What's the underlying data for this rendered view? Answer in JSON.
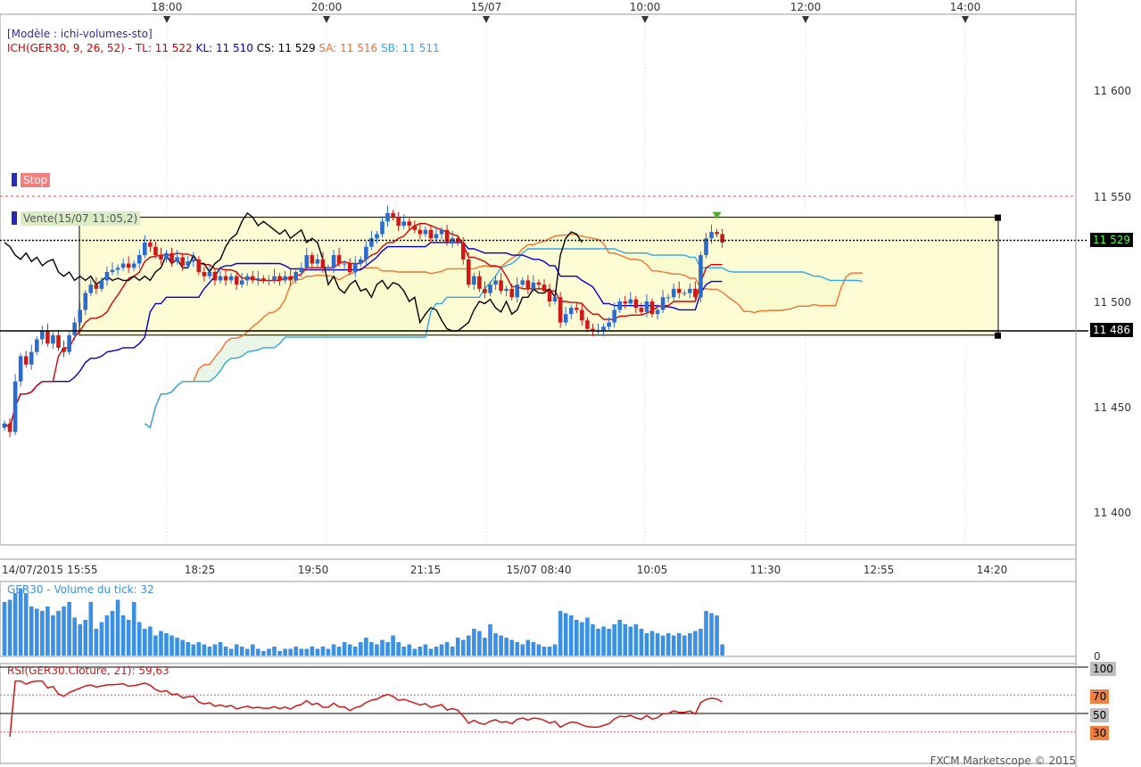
{
  "window": {
    "template_label": "[Modèle : ichi-volumes-sto]",
    "watermark": "FXCM Marketscope © 2015"
  },
  "legend": {
    "ich_label": "ICH(GER30, 9, 26, 52) -",
    "tl": "TL: 11 522",
    "kl": "KL: 11 510",
    "cs": "CS: 11 529",
    "sa": "SA: 11 516",
    "sb": "SB: 11 511"
  },
  "markers": {
    "stop": "Stop",
    "sell": "Vente(15/07 11:05,2)"
  },
  "price_labels": {
    "current": "11 529",
    "support": "11 486"
  },
  "volume_panel": {
    "label": "GER30 - Volume du tick: 32",
    "zero": "0"
  },
  "rsi_panel": {
    "label": "RSI(GER30.Cloture, 21): 59,63",
    "levels": [
      "100",
      "70",
      "50",
      "30"
    ]
  },
  "colors": {
    "tenkan": "#d40000",
    "kijun": "#0000c8",
    "chikou": "#000000",
    "senkou_a": "#f07030",
    "senkou_b": "#30a8e8",
    "bull_candle": "#2a6bd1",
    "bear_candle": "#d01818",
    "volume": "#3a8fe6",
    "rsi": "#d01818",
    "zone_fill": "#fdfbc6"
  },
  "chart_data": [
    {
      "type": "candlestick",
      "symbol": "GER30",
      "top_time_axis": [
        "18:00",
        "20:00",
        "15/07",
        "10:00",
        "12:00",
        "14:00"
      ],
      "bottom_time_axis": [
        "14/07/2015 15:55",
        "18:25",
        "19:50",
        "21:15",
        "15/07 08:40",
        "10:05",
        "11:30",
        "12:55",
        "14:20"
      ],
      "y_ticks": [
        "11 600",
        "11 550",
        "11 500",
        "11 450",
        "11 400"
      ],
      "ylim": [
        11380,
        11620
      ],
      "stop_level": 11550,
      "box": {
        "top": 11540,
        "bottom": 11484
      },
      "current_price": 11529,
      "support_price": 11486,
      "close": [
        11442,
        11438,
        11462,
        11474,
        11470,
        11476,
        11482,
        11486,
        11480,
        11484,
        11478,
        11476,
        11484,
        11490,
        11496,
        11504,
        11508,
        11506,
        11510,
        11514,
        11515,
        11516,
        11518,
        11516,
        11518,
        11522,
        11528,
        11526,
        11522,
        11520,
        11523,
        11519,
        11521,
        11517,
        11519,
        11520,
        11514,
        11512,
        11514,
        11510,
        11512,
        11510,
        11512,
        11508,
        11510,
        11512,
        11510,
        11511,
        11510,
        11510,
        11512,
        11510,
        11512,
        11510,
        11514,
        11516,
        11522,
        11518,
        11520,
        11516,
        11516,
        11522,
        11518,
        11518,
        11514,
        11518,
        11520,
        11526,
        11530,
        11532,
        11538,
        11542,
        11540,
        11536,
        11538,
        11536,
        11534,
        11532,
        11534,
        11530,
        11532,
        11534,
        11528,
        11530,
        11528,
        11520,
        11508,
        11512,
        11506,
        11504,
        11508,
        11510,
        11505,
        11506,
        11502,
        11508,
        11510,
        11506,
        11509,
        11508,
        11505,
        11500,
        11502,
        11490,
        11494,
        11497,
        11496,
        11491,
        11487,
        11486,
        11486,
        11488,
        11490,
        11496,
        11500,
        11499,
        11501,
        11497,
        11495,
        11500,
        11494,
        11496,
        11502,
        11502,
        11506,
        11504,
        11504,
        11506,
        11502,
        11522,
        11530,
        11533,
        11532,
        11528
      ],
      "volume": [
        24,
        25,
        28,
        30,
        28,
        22,
        21,
        20,
        22,
        18,
        20,
        22,
        24,
        17,
        14,
        16,
        24,
        12,
        15,
        18,
        20,
        25,
        18,
        16,
        24,
        15,
        12,
        13,
        9,
        11,
        10,
        9,
        8,
        7,
        6,
        5,
        6,
        5,
        4,
        5,
        6,
        4,
        3,
        5,
        4,
        3,
        5,
        3,
        2,
        3,
        4,
        2,
        3,
        3,
        4,
        3,
        3,
        4,
        3,
        4,
        3,
        5,
        4,
        6,
        5,
        4,
        6,
        8,
        6,
        5,
        7,
        6,
        9,
        6,
        4,
        5,
        3,
        4,
        5,
        3,
        4,
        5,
        6,
        4,
        8,
        7,
        9,
        12,
        11,
        8,
        14,
        10,
        9,
        8,
        7,
        6,
        5,
        7,
        6,
        5,
        4,
        4,
        5,
        20,
        19,
        18,
        16,
        15,
        17,
        14,
        12,
        13,
        12,
        14,
        16,
        14,
        13,
        14,
        12,
        10,
        11,
        10,
        9,
        10,
        9,
        10,
        9,
        10,
        11,
        12,
        20,
        19,
        18,
        5
      ],
      "rsi_levels": [
        70,
        50,
        30
      ],
      "rsi_last": 59.63
    }
  ]
}
